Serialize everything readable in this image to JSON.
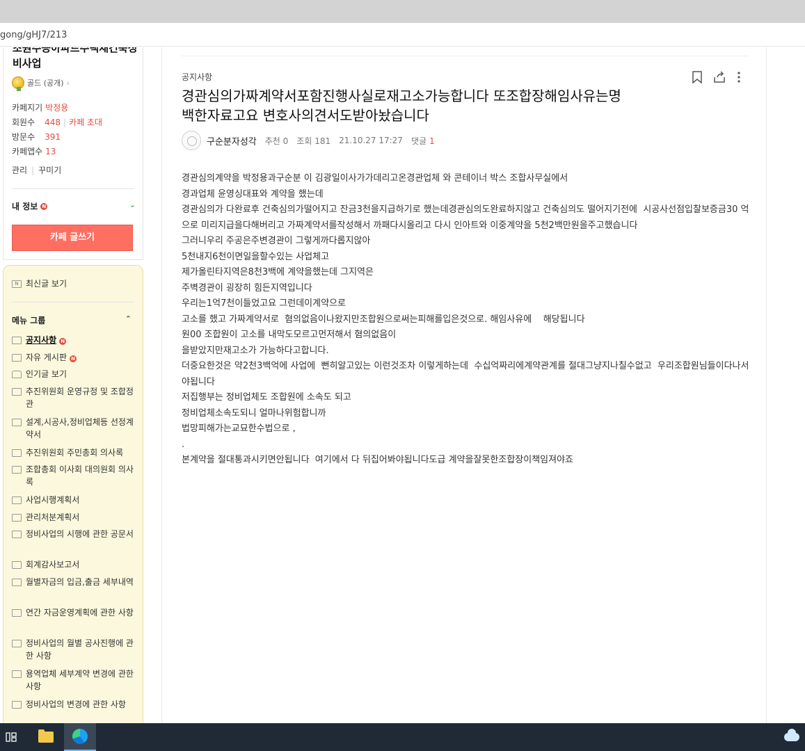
{
  "browser": {
    "url": "gong/gHJ7/213"
  },
  "sidebar": {
    "cafe_name": "조원주공아파트주택재건축정비사업",
    "grade": "골드 (공개)",
    "info": {
      "manager_label": "카페지기",
      "manager_value": "박정용",
      "members_label": "회원수",
      "members_value": "448",
      "invite_label": "카페 초대",
      "visitors_label": "방문수",
      "visitors_value": "391",
      "apps_label": "카페앱수",
      "apps_value": "13"
    },
    "links": {
      "manage": "관리",
      "decorate": "꾸미기"
    },
    "my_info": "내 정보",
    "write_button": "카페 글쓰기",
    "recent": "최신글 보기",
    "menu_group": "메뉴 그룹",
    "menu": [
      {
        "label": "공지사항",
        "new": "N"
      },
      {
        "label": "자유 게시판",
        "new": "N"
      },
      {
        "label": "인기글 보기"
      },
      {
        "label": "추진위원회 운영규정 및 조합정관"
      },
      {
        "label": "설계,시공사,정비업체등 선정계약서"
      },
      {
        "label": "추진위원회 주민총회 의사록"
      },
      {
        "label": "조합총회 이사회 대의원회 의사록"
      },
      {
        "label": "사업시행계획서"
      },
      {
        "label": "관리처분계획서"
      },
      {
        "label": "정비사업의 시행에 관한 공문서"
      },
      {
        "label": "회계감사보고서"
      },
      {
        "label": "월별자금의 입금,출금 세부내역"
      },
      {
        "label": "연간 자금운영계획에 관한 사항"
      },
      {
        "label": "정비사업의 월별 공사진행에 관한 사항"
      },
      {
        "label": "용역업체 세부계약 변경에 관한 사항"
      },
      {
        "label": "정비사업의 변경에 관한 사항"
      }
    ]
  },
  "post": {
    "board": "공지사항",
    "title_line1": "경관심의가짜계약서포함진행사실로재고소가능합니다 또조합장해임사유는명",
    "title_line2": "백한자료고요 변호사의견서도받아놨습니다",
    "author": "구순분자성각",
    "recommend": "추천 0",
    "views": "조회 181",
    "date": "21.10.27 17:27",
    "comments_label": "댓글",
    "comments_count": "1",
    "body": [
      "경관심의계약을 박정용과구순분 이 김광일이사가가데리고온경관업체 와 콘테이너 박스 조합사무실에서",
      "경과업체 윤영싱대표와 계약을 했는데",
      "경관심의가 다완료후 건축심의가떨어지고 잔금3천을지급하기로 했는데경관심의도완료하지않고 건축심의도 떨어지기전에  시공사선점입찰보증금30 억으로 미리지급을다해버리고 가짜계약서를작성해서 까패다시올리고 다시 인아트와 이중계약을 5천2백만원을주고했습니다",
      "그러니우리 주공은주변경관이 그렇게까다롭지않아",
      "5천내지6천이면일을할수있는 사업체고",
      "제가올린타지역은8천3백에 계약을했는데 그지역은",
      "주벽경관이 굉장히 힘든지역입니다",
      "우리는1억7천이들었고요 그런데이계약으로",
      "고소를 했고 가짜계약서로  혐의없음이나왔지만조합원으로써는피해를입은것으로. 해임사유에    해당됩니다",
      "원00 조합원이 고소를 내막도모르고먼저해서 혐의없음이",
      "을받았지만재고소가 가능하다고합니다.",
      "더중요한것은 약2천3백억에 사업에  뻔히알고있는 이런것조차 이렇게하는데  수십억짜리에계약관계를 절대그냥지나칠수없고  우리조합원님들이다나서야됩니다",
      "저집행부는 정비업체도 조합원에 소속도 되고",
      "정비업체소속도되니 얼마나위험합니까",
      "법망피해가는교묘한수법으로 ,",
      ".",
      "본계약을 절대통과시키면안됩니다  여기에서 다 뒤집어봐야됩니다도급 계약을잘못한조합장이책임져야죠"
    ]
  },
  "icons": [
    "bookmark-icon",
    "share-icon",
    "more-icon",
    "task-view-icon",
    "file-explorer-icon",
    "edge-icon",
    "onedrive-icon"
  ]
}
